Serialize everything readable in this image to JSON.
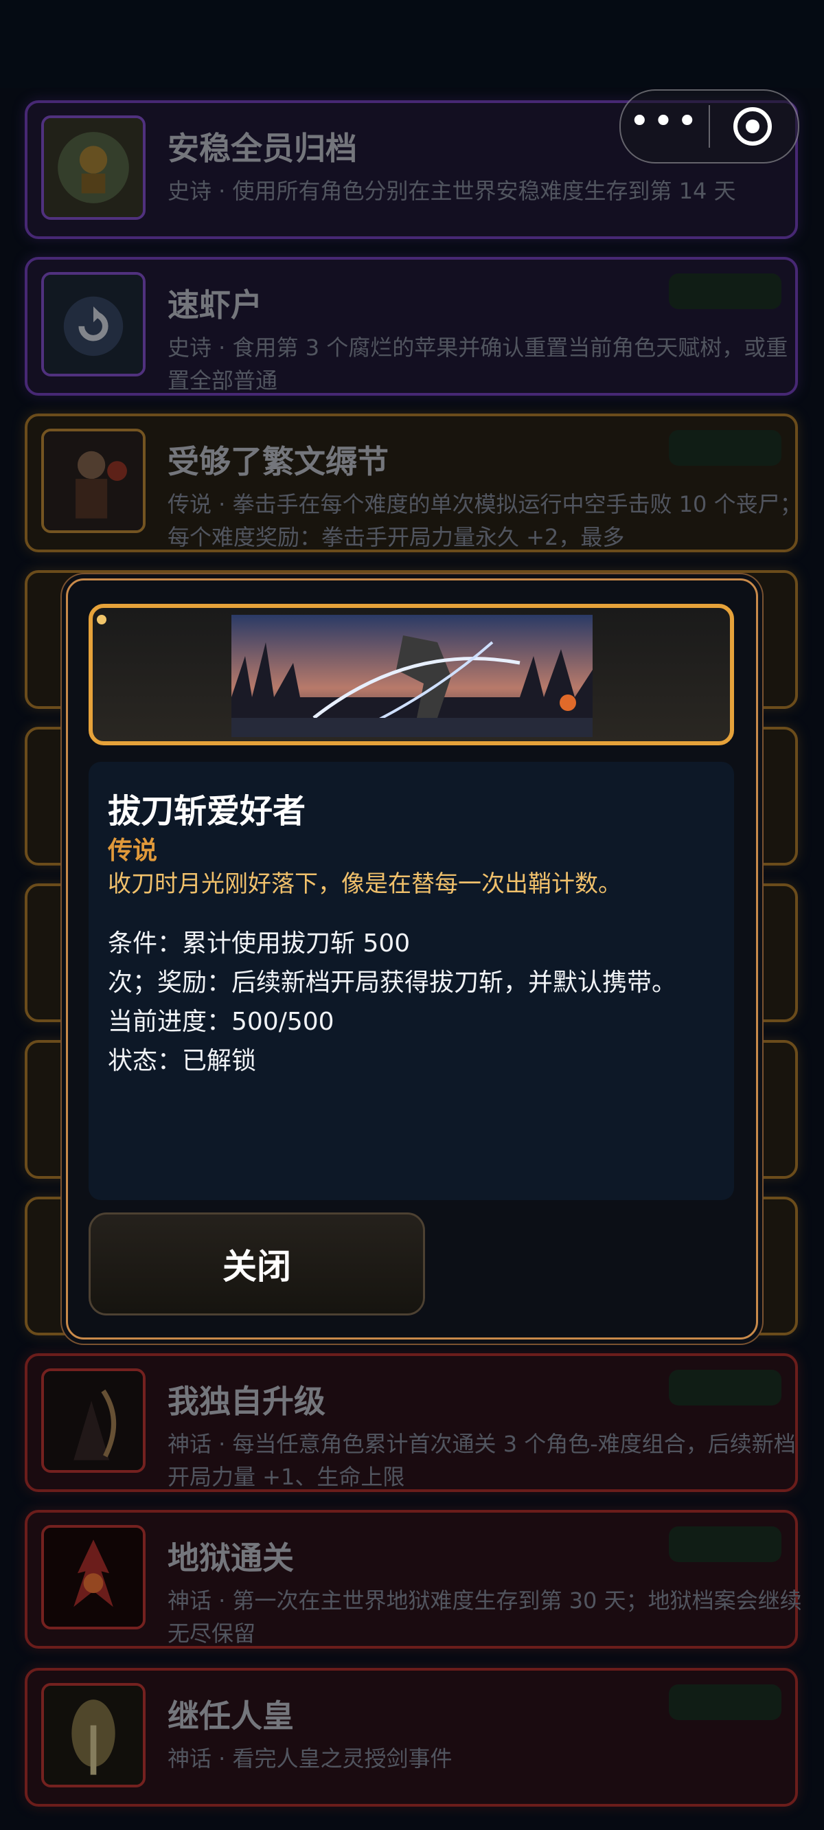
{
  "capsule": {
    "more_icon": "more-dots-icon",
    "target_icon": "target-icon"
  },
  "achievements": [
    {
      "title": "安稳全员归档",
      "desc": "史诗 · 使用所有角色分别在主世界安稳难度生存到第 14 天",
      "rarity": "epic"
    },
    {
      "title": "速虾户",
      "desc": "史诗 · 食用第 3 个腐烂的苹果并确认重置当前角色天赋树，或重置全部普通",
      "rarity": "epic"
    },
    {
      "title": "受够了繁文缛节",
      "desc": "传说 · 拳击手在每个难度的单次模拟运行中空手击败 10 个丧尸；每个难度奖励：拳击手开局力量永久 +2，最多",
      "rarity": "legend"
    },
    {
      "title": "我独自升级",
      "desc": "神话 · 每当任意角色累计首次通关 3 个角色-难度组合，后续新档开局力量 +1、生命上限",
      "rarity": "myth"
    },
    {
      "title": "地狱通关",
      "desc": "神话 · 第一次在主世界地狱难度生存到第 30 天；地狱档案会继续无尽保留",
      "rarity": "myth"
    },
    {
      "title": "继任人皇",
      "desc": "神话 · 看完人皇之灵授剑事件",
      "rarity": "myth"
    }
  ],
  "modal": {
    "title": "拔刀斩爱好者",
    "rarity": "传说",
    "flavor": "收刀时月光刚好落下，像是在替每一次出鞘计数。",
    "condition": "条件：累计使用拔刀斩 500",
    "reward": "次；奖励：后续新档开局获得拔刀斩，并默认携带。",
    "progress": "当前进度：500/500",
    "status": "状态：已解锁",
    "close_label": "关闭"
  },
  "colors": {
    "epic": "#7a45c9",
    "legend": "#b9842f",
    "myth": "#b8322f",
    "modal_rarity": "#e0993a",
    "modal_flavor": "#f0c06b"
  }
}
